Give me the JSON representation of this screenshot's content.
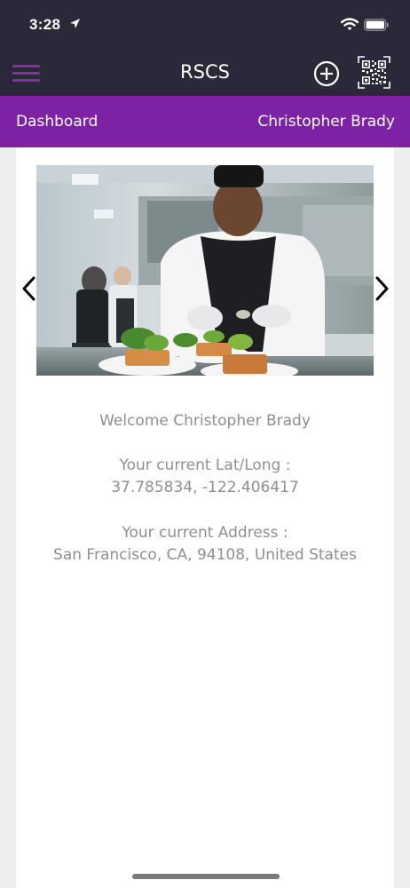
{
  "status": {
    "time": "3:28"
  },
  "nav": {
    "title": "RSCS"
  },
  "subheader": {
    "left": "Dashboard",
    "right": "Christopher Brady"
  },
  "main": {
    "welcome": "Welcome Christopher Brady",
    "latlong_label": "Your current Lat/Long :",
    "latlong_value": "37.785834, -122.406417",
    "address_label": "Your current Address :",
    "address_value": "San Francisco, CA, 94108, United States"
  },
  "colors": {
    "top_bar": "#2b2839",
    "accent": "#7e22a5",
    "menu_icon": "#8a2ba8",
    "body_text": "#8f8f8f"
  },
  "icons": [
    "location-arrow-icon",
    "wifi-icon",
    "battery-icon",
    "hamburger-menu-icon",
    "add-circle-icon",
    "qr-code-icon",
    "chevron-left-icon",
    "chevron-right-icon"
  ]
}
